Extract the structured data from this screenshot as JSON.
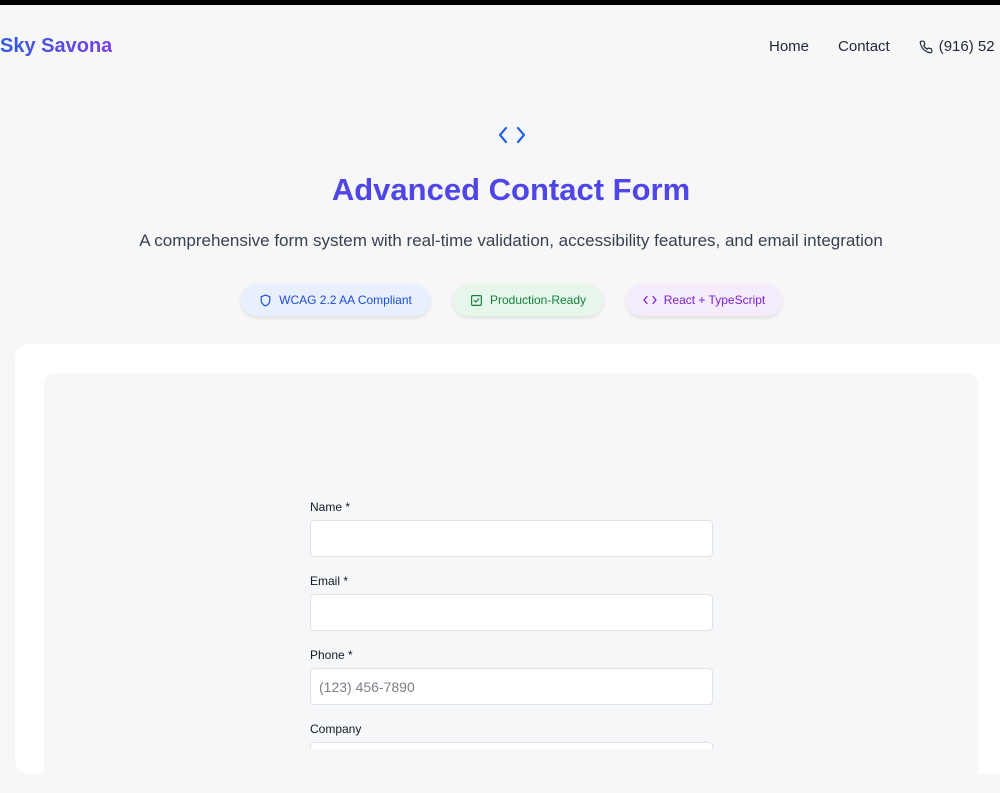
{
  "nav": {
    "brand": "Sky Savona",
    "links": [
      "Home",
      "Contact"
    ],
    "phone": "(916) 52",
    "phone_icon": "phone-icon"
  },
  "hero": {
    "icon": "code-icon",
    "title": "Advanced Contact Form",
    "subtitle": "A comprehensive form system with real-time validation, accessibility features, and email integration",
    "badges": [
      {
        "label": "WCAG 2.2 AA Compliant",
        "icon": "shield-icon",
        "color": "#1d4ed8"
      },
      {
        "label": "Production-Ready",
        "icon": "check-square-icon",
        "color": "#15803d"
      },
      {
        "label": "React + TypeScript",
        "icon": "code-icon",
        "color": "#7e22ce"
      }
    ]
  },
  "form": {
    "name_label": "Name *",
    "name_value": "",
    "email_label": "Email *",
    "email_value": "",
    "phone_label": "Phone *",
    "phone_placeholder": "(123) 456-7890",
    "company_label": "Company",
    "company_value": ""
  },
  "colors": {
    "accent": "#4f46e5",
    "brand_gradient_start": "#2f5bdc",
    "brand_gradient_end": "#7a3ee6"
  }
}
